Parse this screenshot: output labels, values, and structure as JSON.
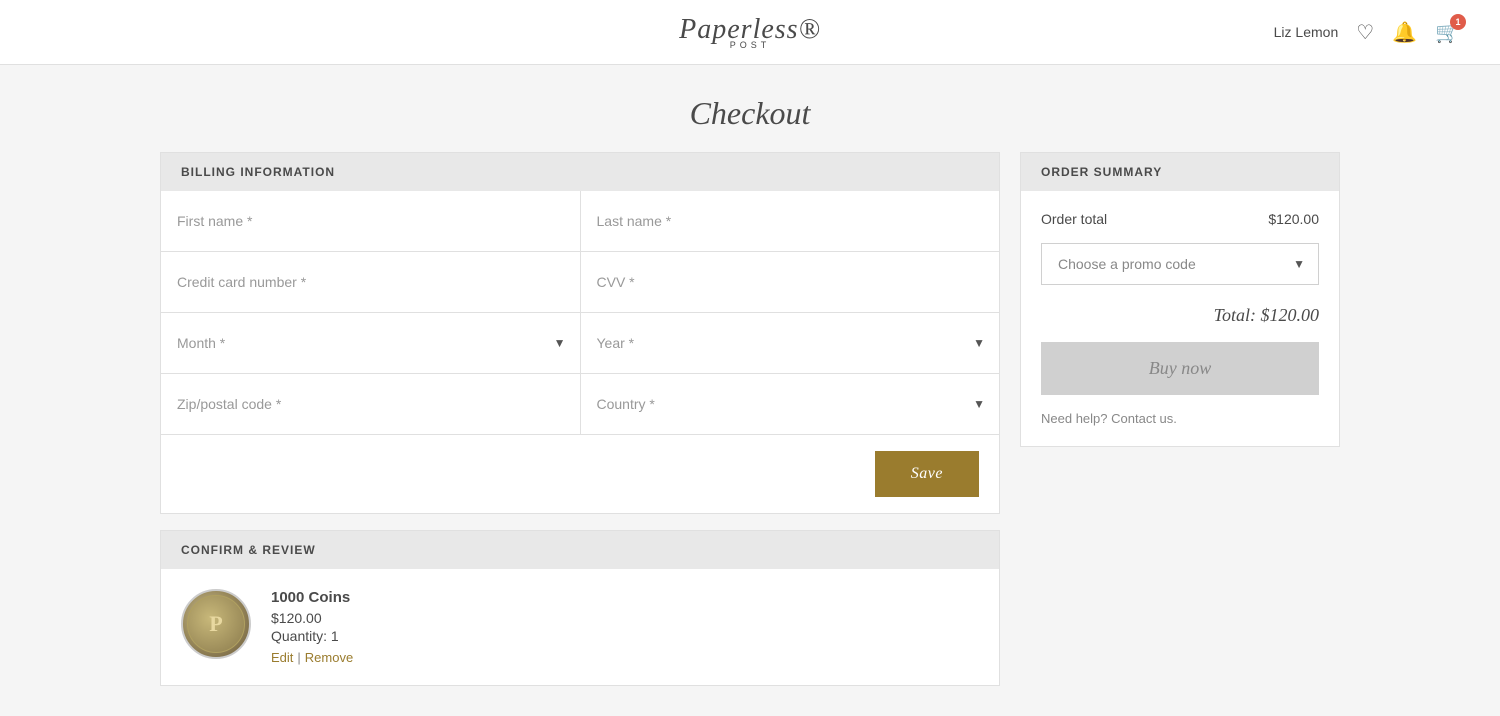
{
  "header": {
    "username": "Liz Lemon",
    "cart_badge": "1"
  },
  "logo": {
    "name": "Paperless®",
    "sub": "POST"
  },
  "page": {
    "title": "Checkout"
  },
  "billing": {
    "section_label": "BILLING INFORMATION",
    "first_name_placeholder": "First name *",
    "last_name_placeholder": "Last name *",
    "credit_card_placeholder": "Credit card number *",
    "cvv_placeholder": "CVV *",
    "month_placeholder": "Month *",
    "year_placeholder": "Year *",
    "zip_placeholder": "Zip/postal code *",
    "country_placeholder": "Country *",
    "save_label": "Save"
  },
  "confirm": {
    "section_label": "CONFIRM & REVIEW",
    "product_name": "1000 Coins",
    "product_price": "$120.00",
    "product_qty": "Quantity: 1",
    "edit_label": "Edit",
    "remove_label": "Remove"
  },
  "order_summary": {
    "section_label": "ORDER SUMMARY",
    "order_total_label": "Order total",
    "order_total_amount": "$120.00",
    "promo_placeholder": "Choose a promo code",
    "total_text": "Total: $120.00",
    "buy_label": "Buy now",
    "help_text": "Need help?",
    "contact_text": "Contact us."
  }
}
